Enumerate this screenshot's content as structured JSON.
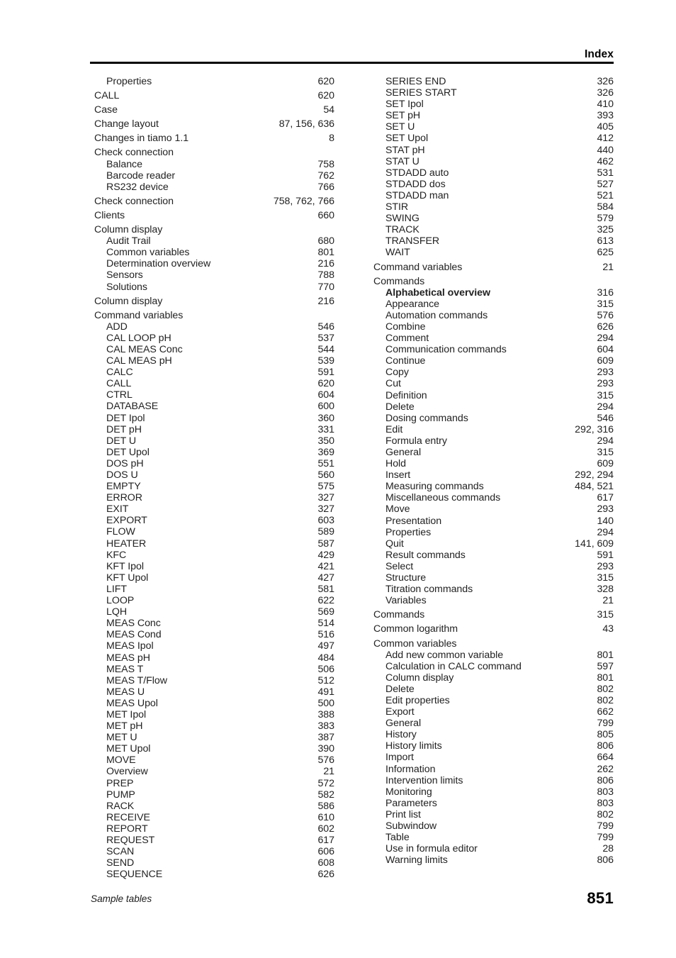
{
  "header": {
    "title": "Index"
  },
  "footer": {
    "section": "Sample tables",
    "page_number": "851"
  },
  "columns": {
    "left": [
      {
        "label": "Properties",
        "pages": "620",
        "level": 2,
        "bold": false
      },
      {
        "label": "CALL",
        "pages": "620",
        "level": 1,
        "bold": false
      },
      {
        "label": "Case",
        "pages": "54",
        "level": 1,
        "bold": false
      },
      {
        "label": "Change layout",
        "pages": "87, 156, 636",
        "level": 1,
        "bold": false
      },
      {
        "label": "Changes in tiamo 1.1",
        "pages": "8",
        "level": 1,
        "bold": false
      },
      {
        "label": "Check connection",
        "pages": "",
        "level": 1,
        "bold": false
      },
      {
        "label": "Balance",
        "pages": "758",
        "level": 2,
        "bold": false
      },
      {
        "label": "Barcode reader",
        "pages": "762",
        "level": 2,
        "bold": false
      },
      {
        "label": "RS232 device",
        "pages": "766",
        "level": 2,
        "bold": false
      },
      {
        "label": "Check connection",
        "pages": "758, 762, 766",
        "level": 1,
        "bold": false
      },
      {
        "label": "Clients",
        "pages": "660",
        "level": 1,
        "bold": false
      },
      {
        "label": "Column display",
        "pages": "",
        "level": 1,
        "bold": false
      },
      {
        "label": "Audit Trail",
        "pages": "680",
        "level": 2,
        "bold": false
      },
      {
        "label": "Common variables",
        "pages": "801",
        "level": 2,
        "bold": false
      },
      {
        "label": "Determination overview",
        "pages": "216",
        "level": 2,
        "bold": false
      },
      {
        "label": "Sensors",
        "pages": "788",
        "level": 2,
        "bold": false
      },
      {
        "label": "Solutions",
        "pages": "770",
        "level": 2,
        "bold": false
      },
      {
        "label": "Column display",
        "pages": "216",
        "level": 1,
        "bold": false
      },
      {
        "label": "Command variables",
        "pages": "",
        "level": 1,
        "bold": false
      },
      {
        "label": "ADD",
        "pages": "546",
        "level": 2,
        "bold": false
      },
      {
        "label": "CAL LOOP pH",
        "pages": "537",
        "level": 2,
        "bold": false
      },
      {
        "label": "CAL MEAS Conc",
        "pages": "544",
        "level": 2,
        "bold": false
      },
      {
        "label": "CAL MEAS pH",
        "pages": "539",
        "level": 2,
        "bold": false
      },
      {
        "label": "CALC",
        "pages": "591",
        "level": 2,
        "bold": false
      },
      {
        "label": "CALL",
        "pages": "620",
        "level": 2,
        "bold": false
      },
      {
        "label": "CTRL",
        "pages": "604",
        "level": 2,
        "bold": false
      },
      {
        "label": "DATABASE",
        "pages": "600",
        "level": 2,
        "bold": false
      },
      {
        "label": "DET Ipol",
        "pages": "360",
        "level": 2,
        "bold": false
      },
      {
        "label": "DET pH",
        "pages": "331",
        "level": 2,
        "bold": false
      },
      {
        "label": "DET U",
        "pages": "350",
        "level": 2,
        "bold": false
      },
      {
        "label": "DET Upol",
        "pages": "369",
        "level": 2,
        "bold": false
      },
      {
        "label": "DOS pH",
        "pages": "551",
        "level": 2,
        "bold": false
      },
      {
        "label": "DOS U",
        "pages": "560",
        "level": 2,
        "bold": false
      },
      {
        "label": "EMPTY",
        "pages": "575",
        "level": 2,
        "bold": false
      },
      {
        "label": "ERROR",
        "pages": "327",
        "level": 2,
        "bold": false
      },
      {
        "label": "EXIT",
        "pages": "327",
        "level": 2,
        "bold": false
      },
      {
        "label": "EXPORT",
        "pages": "603",
        "level": 2,
        "bold": false
      },
      {
        "label": "FLOW",
        "pages": "589",
        "level": 2,
        "bold": false
      },
      {
        "label": "HEATER",
        "pages": "587",
        "level": 2,
        "bold": false
      },
      {
        "label": "KFC",
        "pages": "429",
        "level": 2,
        "bold": false
      },
      {
        "label": "KFT Ipol",
        "pages": "421",
        "level": 2,
        "bold": false
      },
      {
        "label": "KFT Upol",
        "pages": "427",
        "level": 2,
        "bold": false
      },
      {
        "label": "LIFT",
        "pages": "581",
        "level": 2,
        "bold": false
      },
      {
        "label": "LOOP",
        "pages": "622",
        "level": 2,
        "bold": false
      },
      {
        "label": "LQH",
        "pages": "569",
        "level": 2,
        "bold": false
      },
      {
        "label": "MEAS Conc",
        "pages": "514",
        "level": 2,
        "bold": false
      },
      {
        "label": "MEAS Cond",
        "pages": "516",
        "level": 2,
        "bold": false
      },
      {
        "label": "MEAS Ipol",
        "pages": "497",
        "level": 2,
        "bold": false
      },
      {
        "label": "MEAS pH",
        "pages": "484",
        "level": 2,
        "bold": false
      },
      {
        "label": "MEAS T",
        "pages": "506",
        "level": 2,
        "bold": false
      },
      {
        "label": "MEAS T/Flow",
        "pages": "512",
        "level": 2,
        "bold": false
      },
      {
        "label": "MEAS U",
        "pages": "491",
        "level": 2,
        "bold": false
      },
      {
        "label": "MEAS Upol",
        "pages": "500",
        "level": 2,
        "bold": false
      },
      {
        "label": "MET Ipol",
        "pages": "388",
        "level": 2,
        "bold": false
      },
      {
        "label": "MET pH",
        "pages": "383",
        "level": 2,
        "bold": false
      },
      {
        "label": "MET U",
        "pages": "387",
        "level": 2,
        "bold": false
      },
      {
        "label": "MET Upol",
        "pages": "390",
        "level": 2,
        "bold": false
      },
      {
        "label": "MOVE",
        "pages": "576",
        "level": 2,
        "bold": false
      },
      {
        "label": "Overview",
        "pages": "21",
        "level": 2,
        "bold": false
      },
      {
        "label": "PREP",
        "pages": "572",
        "level": 2,
        "bold": false
      },
      {
        "label": "PUMP",
        "pages": "582",
        "level": 2,
        "bold": false
      },
      {
        "label": "RACK",
        "pages": "586",
        "level": 2,
        "bold": false
      },
      {
        "label": "RECEIVE",
        "pages": "610",
        "level": 2,
        "bold": false
      },
      {
        "label": "REPORT",
        "pages": "602",
        "level": 2,
        "bold": false
      },
      {
        "label": "REQUEST",
        "pages": "617",
        "level": 2,
        "bold": false
      },
      {
        "label": "SCAN",
        "pages": "606",
        "level": 2,
        "bold": false
      },
      {
        "label": "SEND",
        "pages": "608",
        "level": 2,
        "bold": false
      },
      {
        "label": "SEQUENCE",
        "pages": "626",
        "level": 2,
        "bold": false
      }
    ],
    "right": [
      {
        "label": "SERIES END",
        "pages": "326",
        "level": 2,
        "bold": false
      },
      {
        "label": "SERIES START",
        "pages": "326",
        "level": 2,
        "bold": false
      },
      {
        "label": "SET Ipol",
        "pages": "410",
        "level": 2,
        "bold": false
      },
      {
        "label": "SET pH",
        "pages": "393",
        "level": 2,
        "bold": false
      },
      {
        "label": "SET U",
        "pages": "405",
        "level": 2,
        "bold": false
      },
      {
        "label": "SET Upol",
        "pages": "412",
        "level": 2,
        "bold": false
      },
      {
        "label": "STAT pH",
        "pages": "440",
        "level": 2,
        "bold": false
      },
      {
        "label": "STAT U",
        "pages": "462",
        "level": 2,
        "bold": false
      },
      {
        "label": "STDADD auto",
        "pages": "531",
        "level": 2,
        "bold": false
      },
      {
        "label": "STDADD dos",
        "pages": "527",
        "level": 2,
        "bold": false
      },
      {
        "label": "STDADD man",
        "pages": "521",
        "level": 2,
        "bold": false
      },
      {
        "label": "STIR",
        "pages": "584",
        "level": 2,
        "bold": false
      },
      {
        "label": "SWING",
        "pages": "579",
        "level": 2,
        "bold": false
      },
      {
        "label": "TRACK",
        "pages": "325",
        "level": 2,
        "bold": false
      },
      {
        "label": "TRANSFER",
        "pages": "613",
        "level": 2,
        "bold": false
      },
      {
        "label": "WAIT",
        "pages": "625",
        "level": 2,
        "bold": false
      },
      {
        "label": "Command variables",
        "pages": "21",
        "level": 1,
        "bold": false
      },
      {
        "label": "Commands",
        "pages": "",
        "level": 1,
        "bold": false
      },
      {
        "label": "Alphabetical overview",
        "pages": "316",
        "level": 2,
        "bold": true
      },
      {
        "label": "Appearance",
        "pages": "315",
        "level": 2,
        "bold": false
      },
      {
        "label": "Automation commands",
        "pages": "576",
        "level": 2,
        "bold": false
      },
      {
        "label": "Combine",
        "pages": "626",
        "level": 2,
        "bold": false
      },
      {
        "label": "Comment",
        "pages": "294",
        "level": 2,
        "bold": false
      },
      {
        "label": "Communication commands",
        "pages": "604",
        "level": 2,
        "bold": false
      },
      {
        "label": "Continue",
        "pages": "609",
        "level": 2,
        "bold": false
      },
      {
        "label": "Copy",
        "pages": "293",
        "level": 2,
        "bold": false
      },
      {
        "label": "Cut",
        "pages": "293",
        "level": 2,
        "bold": false
      },
      {
        "label": "Definition",
        "pages": "315",
        "level": 2,
        "bold": false
      },
      {
        "label": "Delete",
        "pages": "294",
        "level": 2,
        "bold": false
      },
      {
        "label": "Dosing commands",
        "pages": "546",
        "level": 2,
        "bold": false
      },
      {
        "label": "Edit",
        "pages": "292, 316",
        "level": 2,
        "bold": false
      },
      {
        "label": "Formula entry",
        "pages": "294",
        "level": 2,
        "bold": false
      },
      {
        "label": "General",
        "pages": "315",
        "level": 2,
        "bold": false
      },
      {
        "label": "Hold",
        "pages": "609",
        "level": 2,
        "bold": false
      },
      {
        "label": "Insert",
        "pages": "292, 294",
        "level": 2,
        "bold": false
      },
      {
        "label": "Measuring commands",
        "pages": "484, 521",
        "level": 2,
        "bold": false
      },
      {
        "label": "Miscellaneous commands",
        "pages": "617",
        "level": 2,
        "bold": false
      },
      {
        "label": "Move",
        "pages": "293",
        "level": 2,
        "bold": false
      },
      {
        "label": "Presentation",
        "pages": "140",
        "level": 2,
        "bold": false
      },
      {
        "label": "Properties",
        "pages": "294",
        "level": 2,
        "bold": false
      },
      {
        "label": "Quit",
        "pages": "141, 609",
        "level": 2,
        "bold": false
      },
      {
        "label": "Result commands",
        "pages": "591",
        "level": 2,
        "bold": false
      },
      {
        "label": "Select",
        "pages": "293",
        "level": 2,
        "bold": false
      },
      {
        "label": "Structure",
        "pages": "315",
        "level": 2,
        "bold": false
      },
      {
        "label": "Titration commands",
        "pages": "328",
        "level": 2,
        "bold": false
      },
      {
        "label": "Variables",
        "pages": "21",
        "level": 2,
        "bold": false
      },
      {
        "label": "Commands",
        "pages": "315",
        "level": 1,
        "bold": false
      },
      {
        "label": "Common logarithm",
        "pages": "43",
        "level": 1,
        "bold": false
      },
      {
        "label": "Common variables",
        "pages": "",
        "level": 1,
        "bold": false
      },
      {
        "label": "Add new common variable",
        "pages": "801",
        "level": 2,
        "bold": false
      },
      {
        "label": "Calculation in CALC command",
        "pages": "597",
        "level": 2,
        "bold": false
      },
      {
        "label": "Column display",
        "pages": "801",
        "level": 2,
        "bold": false
      },
      {
        "label": "Delete",
        "pages": "802",
        "level": 2,
        "bold": false
      },
      {
        "label": "Edit properties",
        "pages": "802",
        "level": 2,
        "bold": false
      },
      {
        "label": "Export",
        "pages": "662",
        "level": 2,
        "bold": false
      },
      {
        "label": "General",
        "pages": "799",
        "level": 2,
        "bold": false
      },
      {
        "label": "History",
        "pages": "805",
        "level": 2,
        "bold": false
      },
      {
        "label": "History limits",
        "pages": "806",
        "level": 2,
        "bold": false
      },
      {
        "label": "Import",
        "pages": "664",
        "level": 2,
        "bold": false
      },
      {
        "label": "Information",
        "pages": "262",
        "level": 2,
        "bold": false
      },
      {
        "label": "Intervention limits",
        "pages": "806",
        "level": 2,
        "bold": false
      },
      {
        "label": "Monitoring",
        "pages": "803",
        "level": 2,
        "bold": false
      },
      {
        "label": "Parameters",
        "pages": "803",
        "level": 2,
        "bold": false
      },
      {
        "label": "Print list",
        "pages": "802",
        "level": 2,
        "bold": false
      },
      {
        "label": "Subwindow",
        "pages": "799",
        "level": 2,
        "bold": false
      },
      {
        "label": "Table",
        "pages": "799",
        "level": 2,
        "bold": false
      },
      {
        "label": "Use in formula editor",
        "pages": "28",
        "level": 2,
        "bold": false
      },
      {
        "label": "Warning limits",
        "pages": "806",
        "level": 2,
        "bold": false
      }
    ]
  }
}
